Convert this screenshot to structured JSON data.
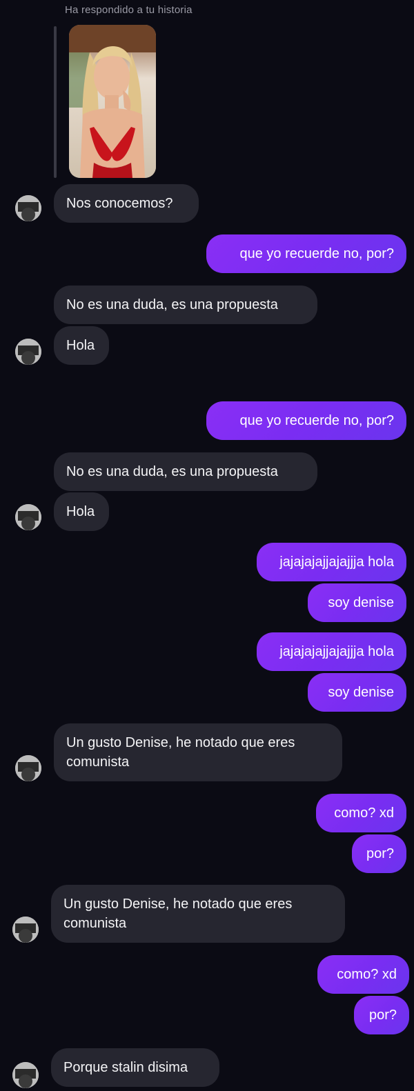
{
  "story_reply": {
    "label": "Ha respondido a tu historia"
  },
  "messages": [
    {
      "sender": "other",
      "text": "Nos conocemos?"
    },
    {
      "sender": "me",
      "text": "que yo recuerde no, por?"
    },
    {
      "sender": "other",
      "text": "No es una duda, es una propuesta"
    },
    {
      "sender": "other",
      "text": "Hola"
    },
    {
      "sender": "me",
      "text": "que yo recuerde no, por?"
    },
    {
      "sender": "other",
      "text": "No es una duda, es una propuesta"
    },
    {
      "sender": "other",
      "text": "Hola"
    },
    {
      "sender": "me",
      "text": "jajajajajjajajjja hola"
    },
    {
      "sender": "me",
      "text": "soy denise"
    },
    {
      "sender": "me",
      "text": "jajajajajjajajjja hola"
    },
    {
      "sender": "me",
      "text": "soy denise"
    },
    {
      "sender": "other",
      "text": "Un gusto Denise, he notado que eres comunista"
    },
    {
      "sender": "me",
      "text": "como? xd"
    },
    {
      "sender": "me",
      "text": "por?"
    },
    {
      "sender": "other",
      "text": "Un gusto Denise, he notado que eres comunista"
    },
    {
      "sender": "me",
      "text": "como? xd"
    },
    {
      "sender": "me",
      "text": "por?"
    },
    {
      "sender": "other",
      "text": "Porque stalin disima"
    }
  ],
  "colors": {
    "background": "#0b0b14",
    "incoming_bubble": "#262630",
    "outgoing_bubble": "#7a2df2"
  },
  "icons": {
    "avatar": "profile-avatar",
    "story": "story-thumbnail-image"
  }
}
